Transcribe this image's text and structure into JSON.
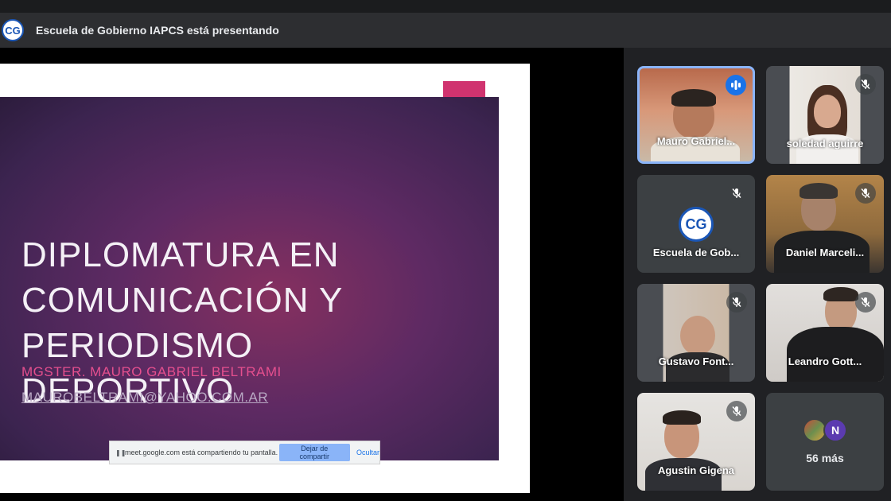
{
  "header": {
    "logo_text": "CG",
    "presenting_text": "Escuela de Gobierno IAPCS está presentando"
  },
  "slide": {
    "title_lines": [
      "DIPLOMATURA EN",
      "COMUNICACIÓN Y",
      "PERIODISMO",
      "DEPORTIVO"
    ],
    "author": "MGSTER. MAURO GABRIEL BELTRAMI",
    "email": "MAUROBELTRAMI@YAHOO.COM.AR",
    "accent_color": "#d0336f"
  },
  "share_bar": {
    "message": "meet.google.com está compartiendo tu pantalla.",
    "stop_label": "Dejar de compartir",
    "hide_label": "Ocultar"
  },
  "participants": [
    {
      "name": "Mauro Gabriel...",
      "status_icon": "speaking-icon",
      "active": true
    },
    {
      "name": "soledad aguirre",
      "status_icon": "mic-off-icon"
    },
    {
      "name": "Escuela de Gob...",
      "status_icon": "mic-off-icon",
      "logo_text": "CG"
    },
    {
      "name": "Daniel Marceli...",
      "status_icon": "mic-off-icon"
    },
    {
      "name": "Gustavo Font...",
      "status_icon": "mic-off-icon"
    },
    {
      "name": "Leandro Gott...",
      "status_icon": "mic-off-icon"
    },
    {
      "name": "Agustin Gigena",
      "status_icon": "mic-off-icon"
    }
  ],
  "others": {
    "avatar_letter": "N",
    "count_label": "56 más"
  },
  "colors": {
    "accent_blue": "#8ab4f8",
    "speaking_blue": "#1a73e8",
    "background": "#202124"
  }
}
